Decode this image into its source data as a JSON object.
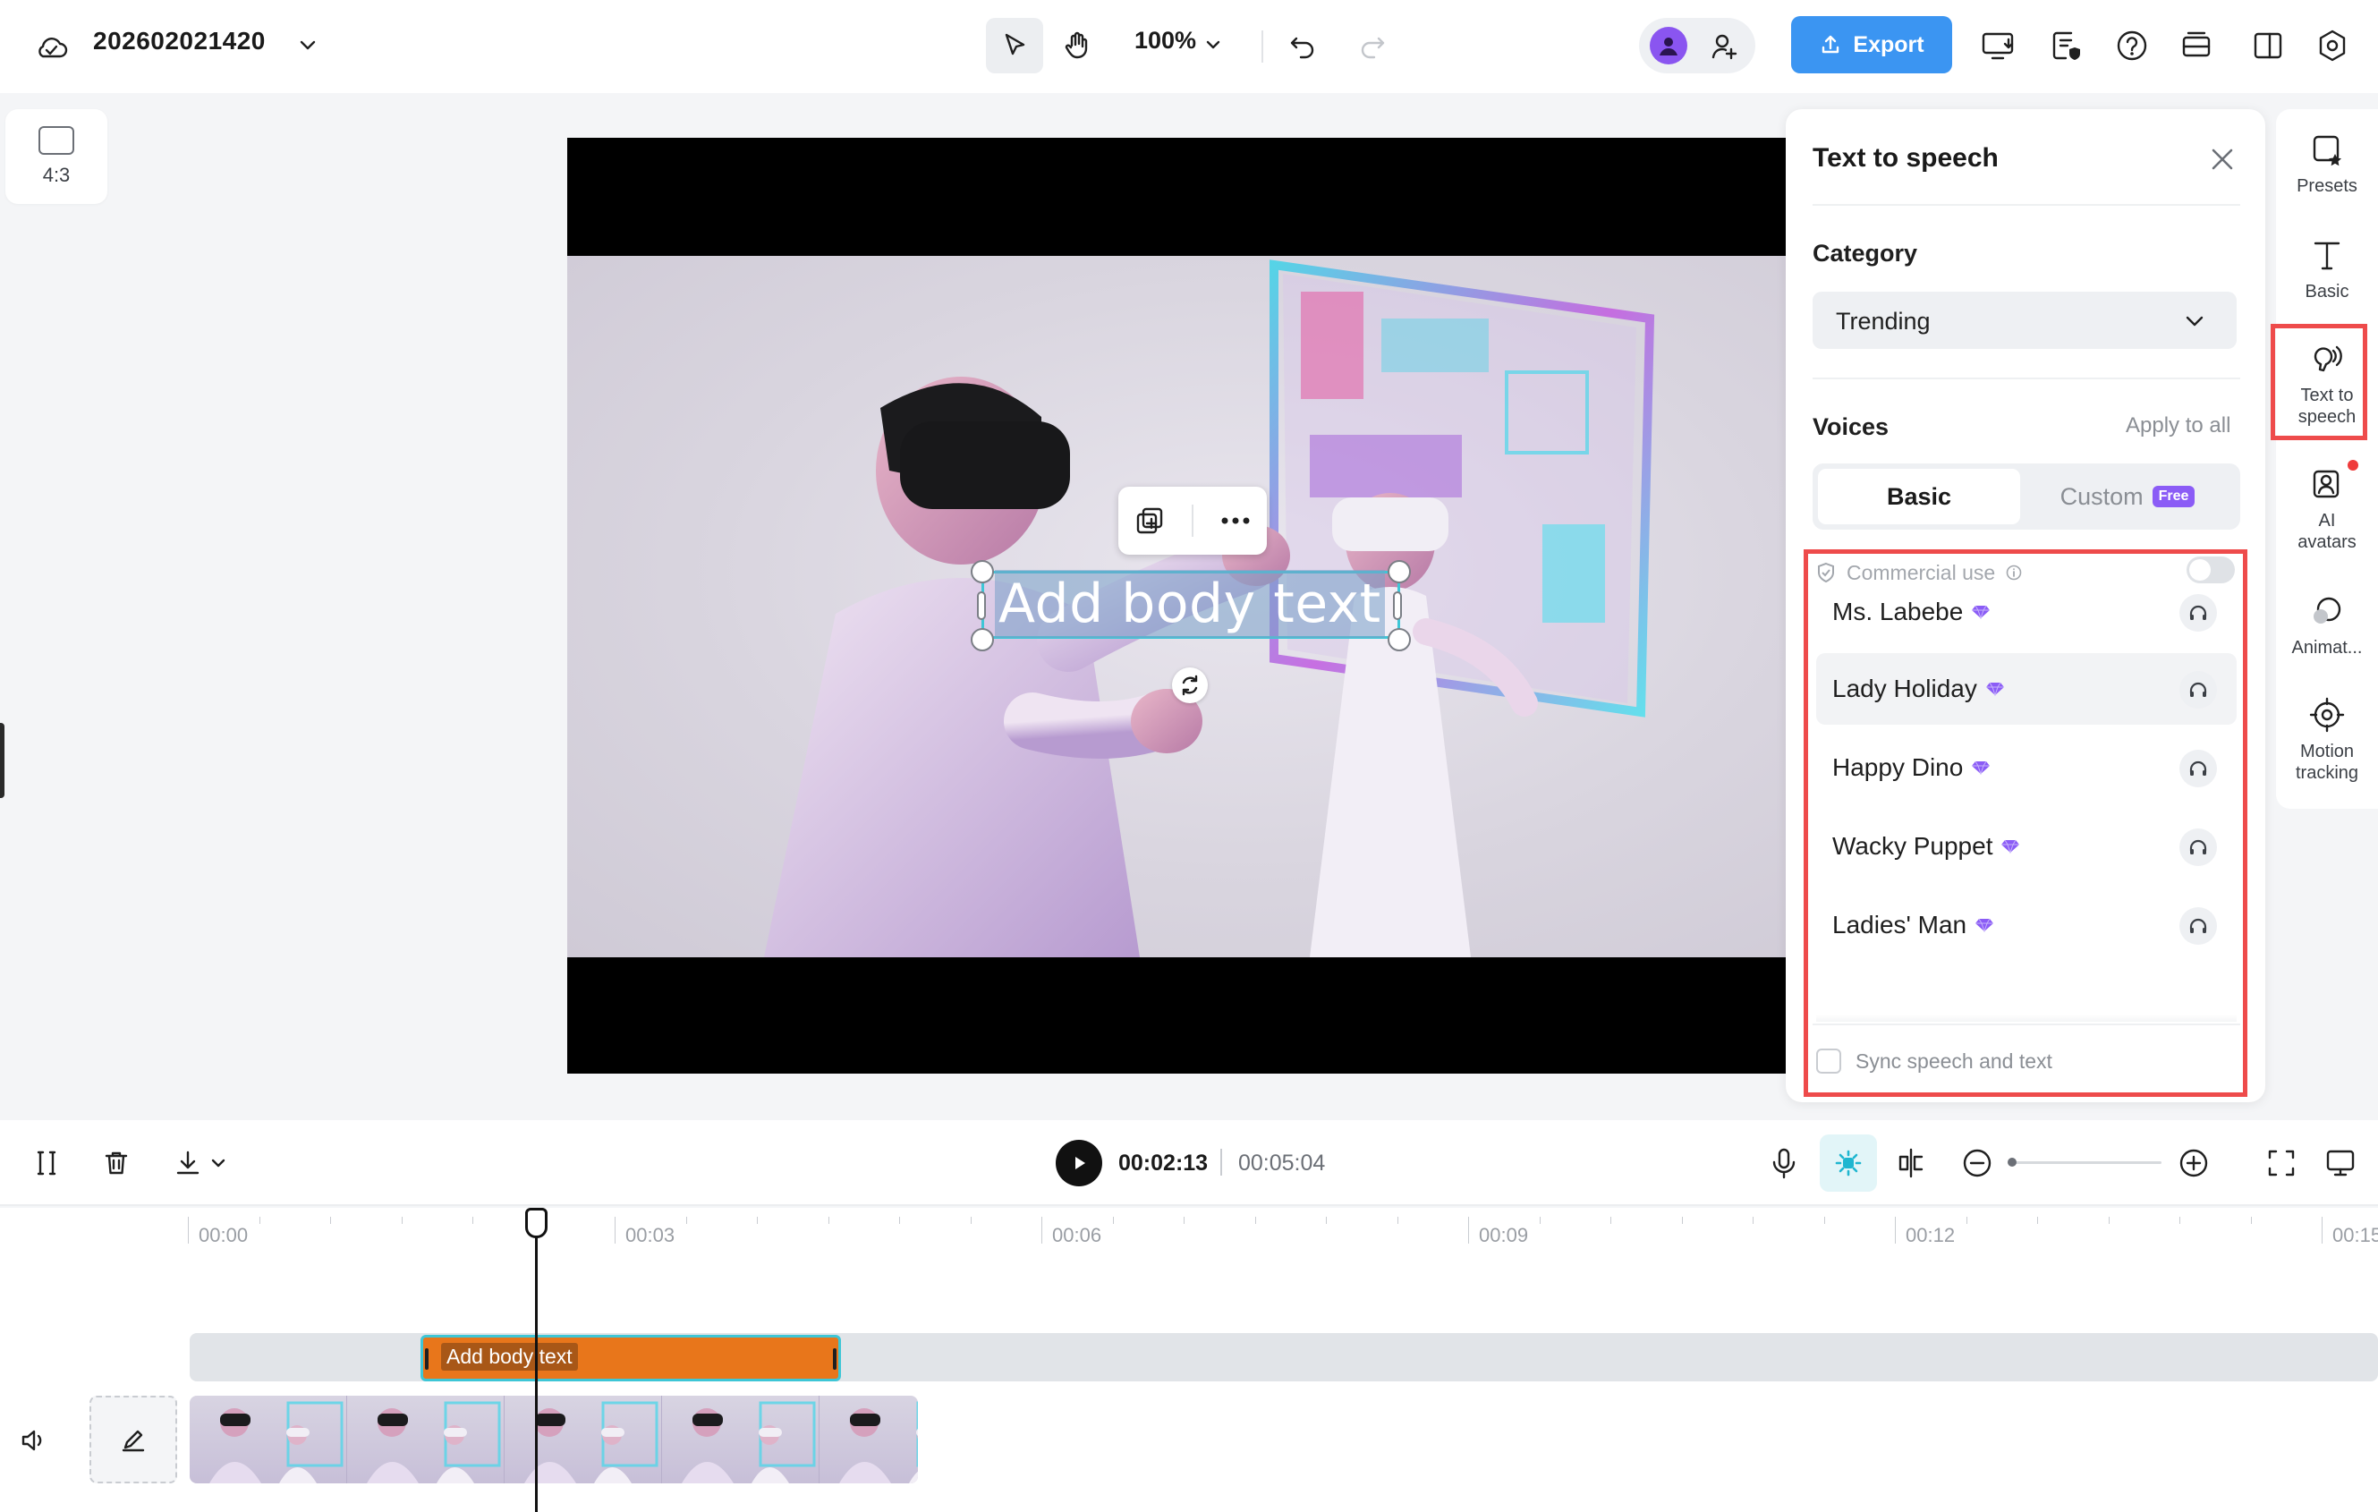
{
  "topbar": {
    "project_name": "202602021420",
    "zoom": "100%",
    "export_label": "Export"
  },
  "workspace": {
    "aspect_ratio": "4:3",
    "canvas_text": "Add body text"
  },
  "tts_panel": {
    "title": "Text to speech",
    "category_label": "Category",
    "category_value": "Trending",
    "voices_label": "Voices",
    "apply_all": "Apply to all",
    "tab_basic": "Basic",
    "tab_custom": "Custom",
    "free_badge": "Free",
    "commercial_use": "Commercial use",
    "commercial_use_enabled": false,
    "voices": [
      {
        "name": "Ms. Labebe",
        "premium": true
      },
      {
        "name": "Lady Holiday",
        "premium": true
      },
      {
        "name": "Happy Dino",
        "premium": true
      },
      {
        "name": "Wacky Puppet",
        "premium": true
      },
      {
        "name": "Ladies' Man",
        "premium": true
      }
    ],
    "selected_voice_index": 1,
    "sync_label": "Sync speech and text",
    "sync_checked": false
  },
  "right_rail": {
    "items": [
      {
        "label": "Presets",
        "icon": "presets-icon"
      },
      {
        "label": "Basic",
        "icon": "text-icon"
      },
      {
        "label": "Text to speech",
        "icon": "text-to-speech-icon"
      },
      {
        "label": "AI avatars",
        "icon": "ai-avatar-icon"
      },
      {
        "label": "Animat...",
        "icon": "animation-icon"
      },
      {
        "label": "Motion tracking",
        "icon": "motion-tracking-icon"
      }
    ],
    "active_index": 2
  },
  "timeline": {
    "current_time": "00:02:13",
    "total_time": "00:05:04",
    "ruler_labels": [
      "00:00",
      "00:03",
      "00:06",
      "00:09",
      "00:12",
      "00:15"
    ],
    "text_clip_label": "Add body text"
  },
  "colors": {
    "accent_blue": "#3b95f2",
    "highlight_red": "#ee4b4b",
    "clip_orange": "#e8761b",
    "selection_cyan": "#3ec6d6",
    "premium_purple": "#8b5cf6"
  }
}
